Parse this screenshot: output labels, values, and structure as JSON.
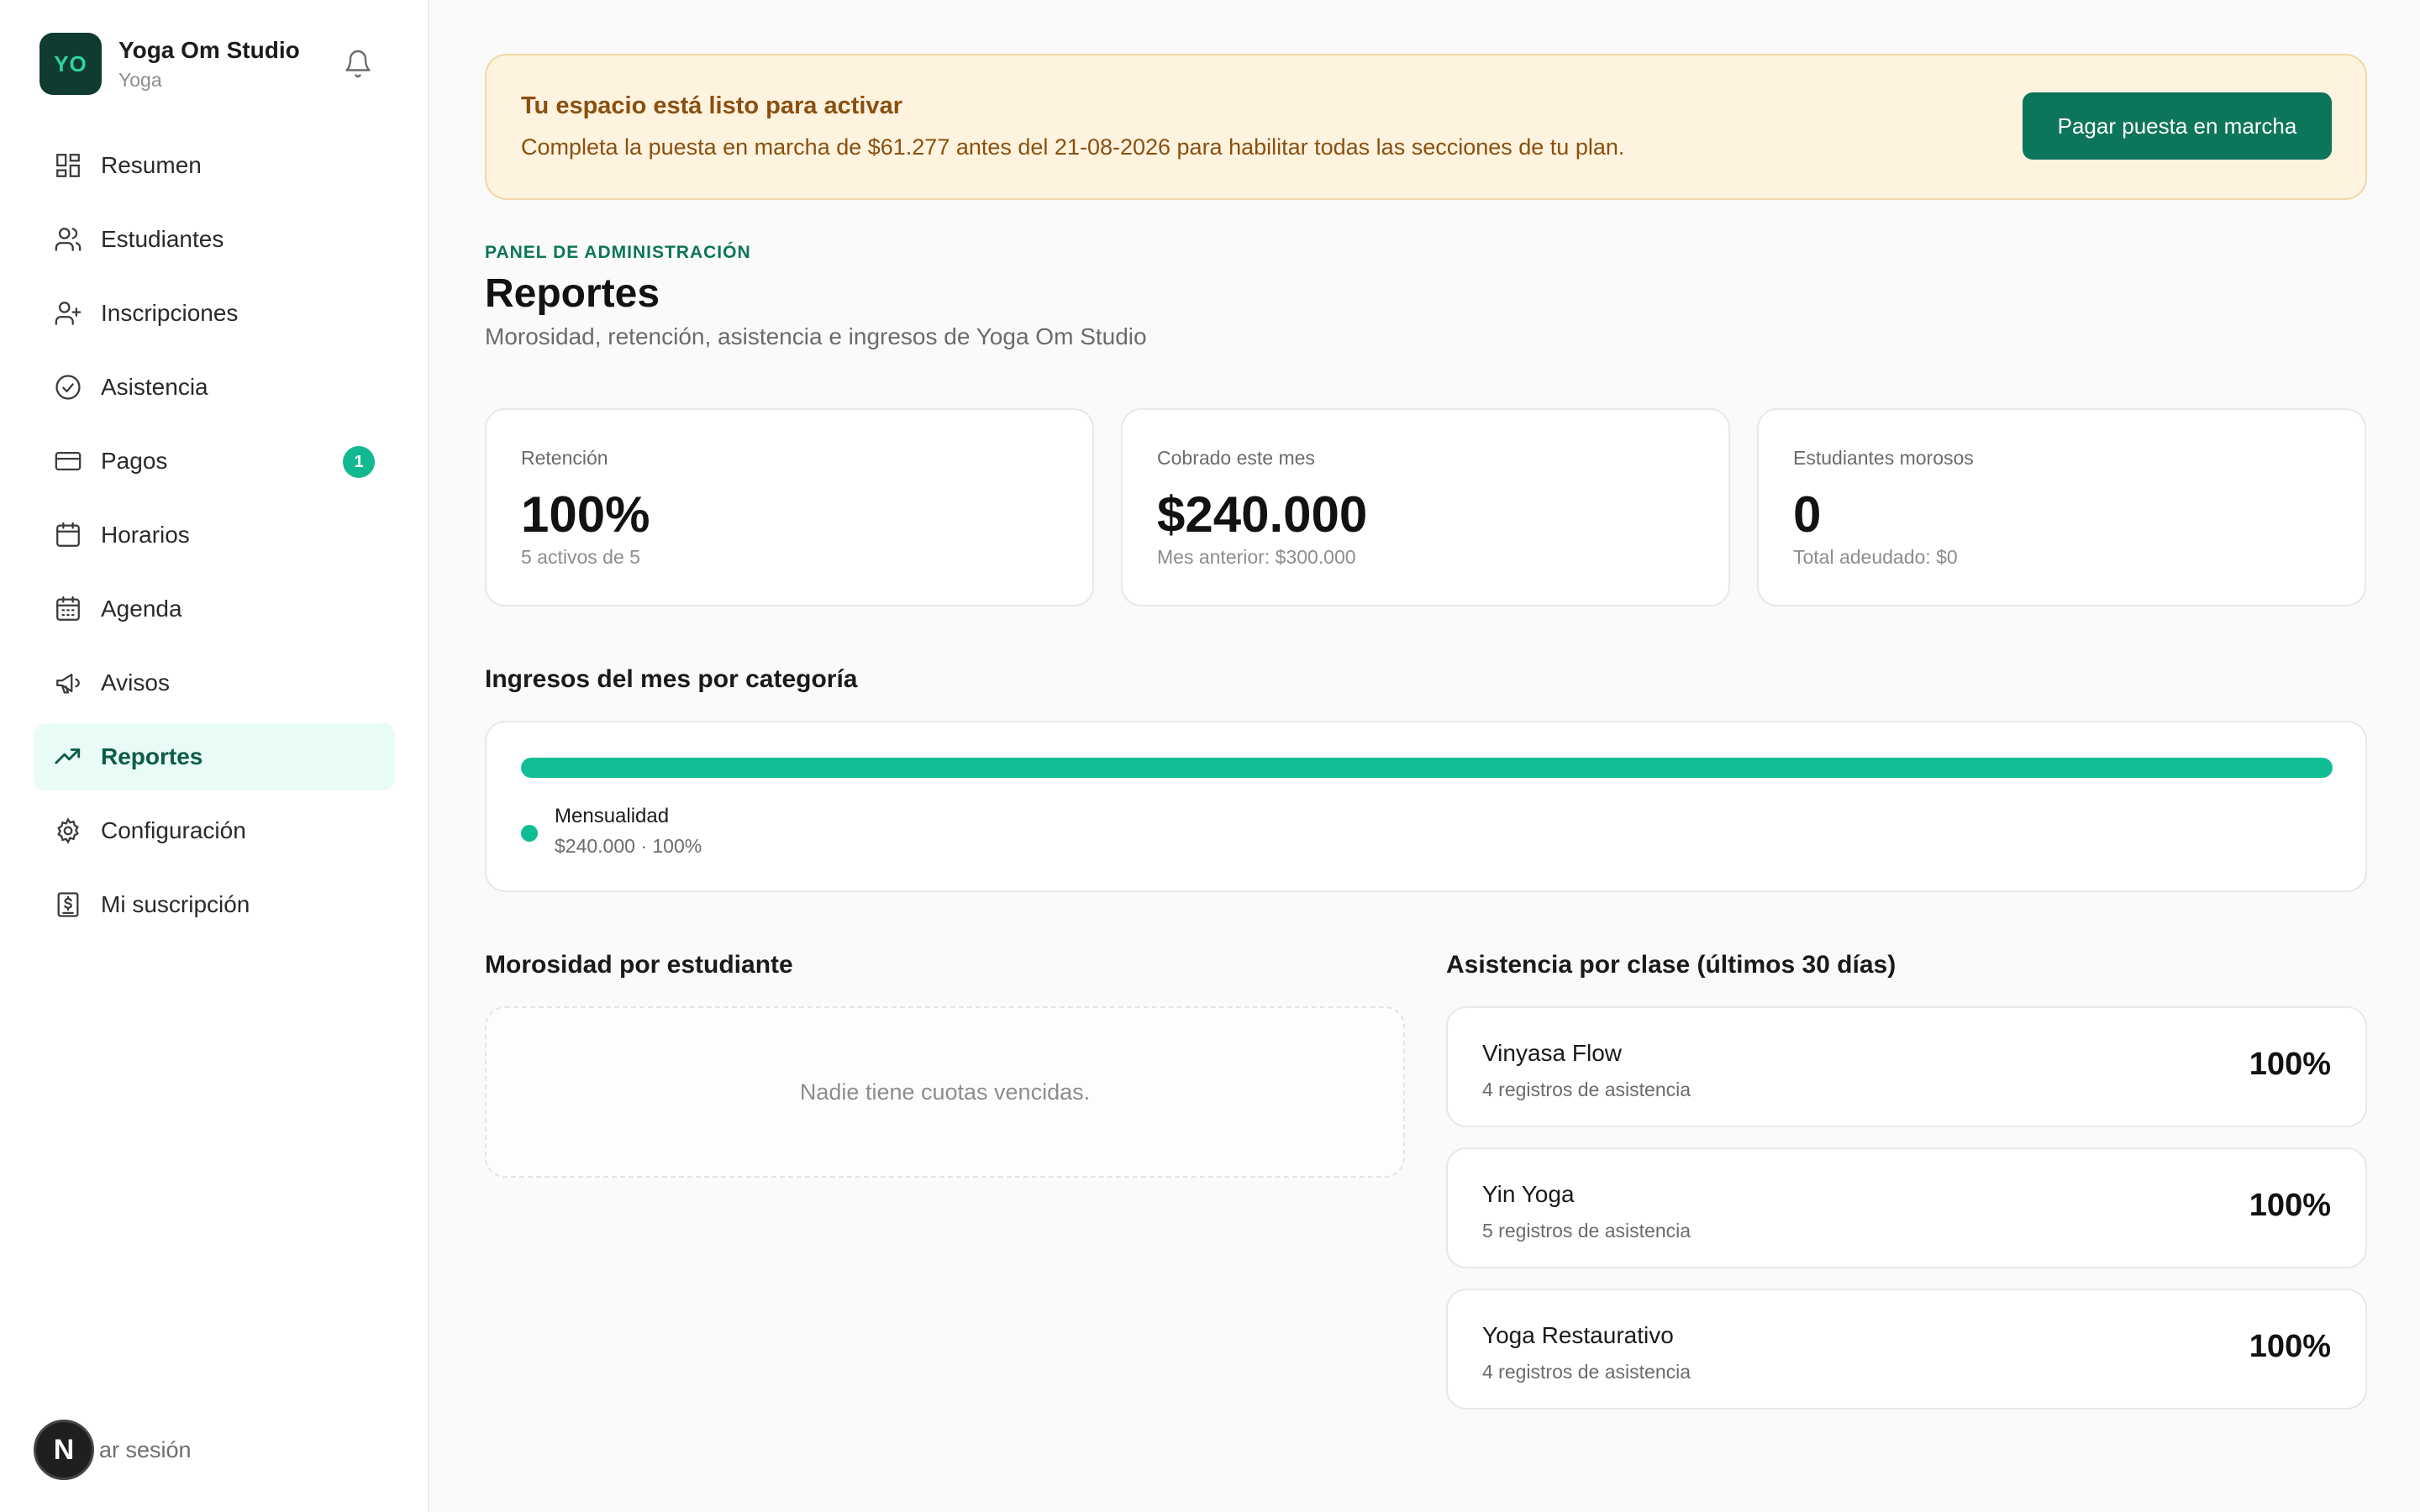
{
  "brand": {
    "initials": "YO",
    "name": "Yoga Om Studio",
    "subtitle": "Yoga",
    "logo_color": "#0f3b30"
  },
  "sidebar": {
    "items": [
      {
        "label": "Resumen",
        "icon": "grid-icon"
      },
      {
        "label": "Estudiantes",
        "icon": "users-icon"
      },
      {
        "label": "Inscripciones",
        "icon": "user-plus-icon"
      },
      {
        "label": "Asistencia",
        "icon": "check-circle-icon"
      },
      {
        "label": "Pagos",
        "icon": "credit-card-icon",
        "badge": "1"
      },
      {
        "label": "Horarios",
        "icon": "calendar-icon"
      },
      {
        "label": "Agenda",
        "icon": "calendar-grid-icon"
      },
      {
        "label": "Avisos",
        "icon": "megaphone-icon"
      },
      {
        "label": "Reportes",
        "icon": "trending-up-icon",
        "active": true
      },
      {
        "label": "Configuración",
        "icon": "gear-icon"
      },
      {
        "label": "Mi suscripción",
        "icon": "receipt-icon"
      }
    ],
    "logout_initial": "N",
    "logout_label": "ar sesión"
  },
  "banner": {
    "title": "Tu espacio está listo para activar",
    "text": "Completa la puesta en marcha de $61.277 antes del 21-08-2026 para habilitar todas las secciones de tu plan.",
    "button": "Pagar puesta en marcha"
  },
  "header": {
    "eyebrow": "PANEL DE ADMINISTRACIÓN",
    "title": "Reportes",
    "subtitle": "Morosidad, retención, asistencia e ingresos de Yoga Om Studio"
  },
  "stats": [
    {
      "label": "Retención",
      "value": "100%",
      "note": "5 activos de 5"
    },
    {
      "label": "Cobrado este mes",
      "value": "$240.000",
      "note": "Mes anterior: $300.000"
    },
    {
      "label": "Estudiantes morosos",
      "value": "0",
      "note": "Total adeudado: $0"
    }
  ],
  "income": {
    "title": "Ingresos del mes por categoría",
    "share": 100,
    "category": "Mensualidad",
    "detail": "$240.000 · 100%",
    "color": "#10bd95"
  },
  "delinquency": {
    "title": "Morosidad por estudiante",
    "empty": "Nadie tiene cuotas vencidas."
  },
  "attendance": {
    "title": "Asistencia por clase (últimos 30 días)",
    "classes": [
      {
        "name": "Vinyasa Flow",
        "records": "4 registros de asistencia",
        "pct": "100%"
      },
      {
        "name": "Yin Yoga",
        "records": "5 registros de asistencia",
        "pct": "100%"
      },
      {
        "name": "Yoga Restaurativo",
        "records": "4 registros de asistencia",
        "pct": "100%"
      }
    ]
  },
  "colors": {
    "accent": "#0d7559",
    "highlight": "#10bd95",
    "banner_bg": "#fdf3df",
    "banner_text": "#8b4f0f"
  }
}
